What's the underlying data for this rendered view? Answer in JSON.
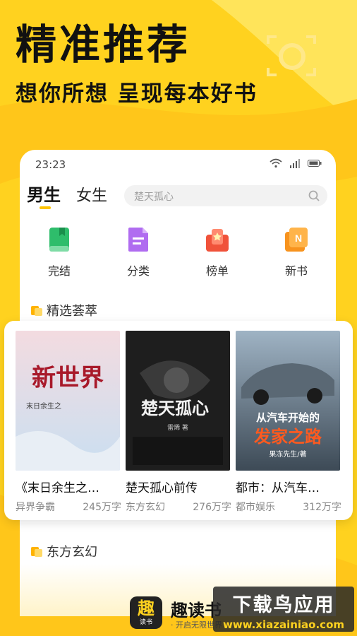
{
  "hero": {
    "title": "精准推荐",
    "subtitle": "想你所想 呈现每本好书"
  },
  "phone": {
    "status_time": "23:23",
    "tabs": [
      {
        "label": "男生",
        "active": true
      },
      {
        "label": "女生",
        "active": false
      }
    ],
    "search": {
      "placeholder": "楚天孤心"
    },
    "categories": [
      {
        "label": "完结",
        "icon": "book-icon",
        "color": "#2ebd6b"
      },
      {
        "label": "分类",
        "icon": "document-icon",
        "color": "#b06cf0"
      },
      {
        "label": "榜单",
        "icon": "ranking-icon",
        "color": "#f0523a"
      },
      {
        "label": "新书",
        "icon": "new-book-icon",
        "color": "#f7931e"
      }
    ],
    "section_featured": "精选荟萃",
    "section_next": "东方玄幻"
  },
  "books": [
    {
      "title": "《末日余生之…",
      "genre": "异界争霸",
      "words": "245万字",
      "cover_text": "新世界",
      "cover_sub": "末日余生之"
    },
    {
      "title": "楚天孤心前传",
      "genre": "东方玄幻",
      "words": "276万字",
      "cover_text": "楚天孤心",
      "cover_sub": "雷烯 著"
    },
    {
      "title": "都市：从汽车…",
      "genre": "都市娱乐",
      "words": "312万字",
      "cover_text": "从汽车开始的",
      "cover_text2": "发家之路",
      "cover_sub": "果冻先生/著"
    }
  ],
  "app": {
    "logo_main": "趣",
    "logo_sub": "读书",
    "name": "趣读书",
    "slogan": "· 开启无限世界"
  },
  "watermark": {
    "main": "下载鸟应用",
    "url": "www.xiazainiao.com"
  },
  "colors": {
    "brand_yellow": "#ffd21f",
    "accent": "#ffc400"
  }
}
